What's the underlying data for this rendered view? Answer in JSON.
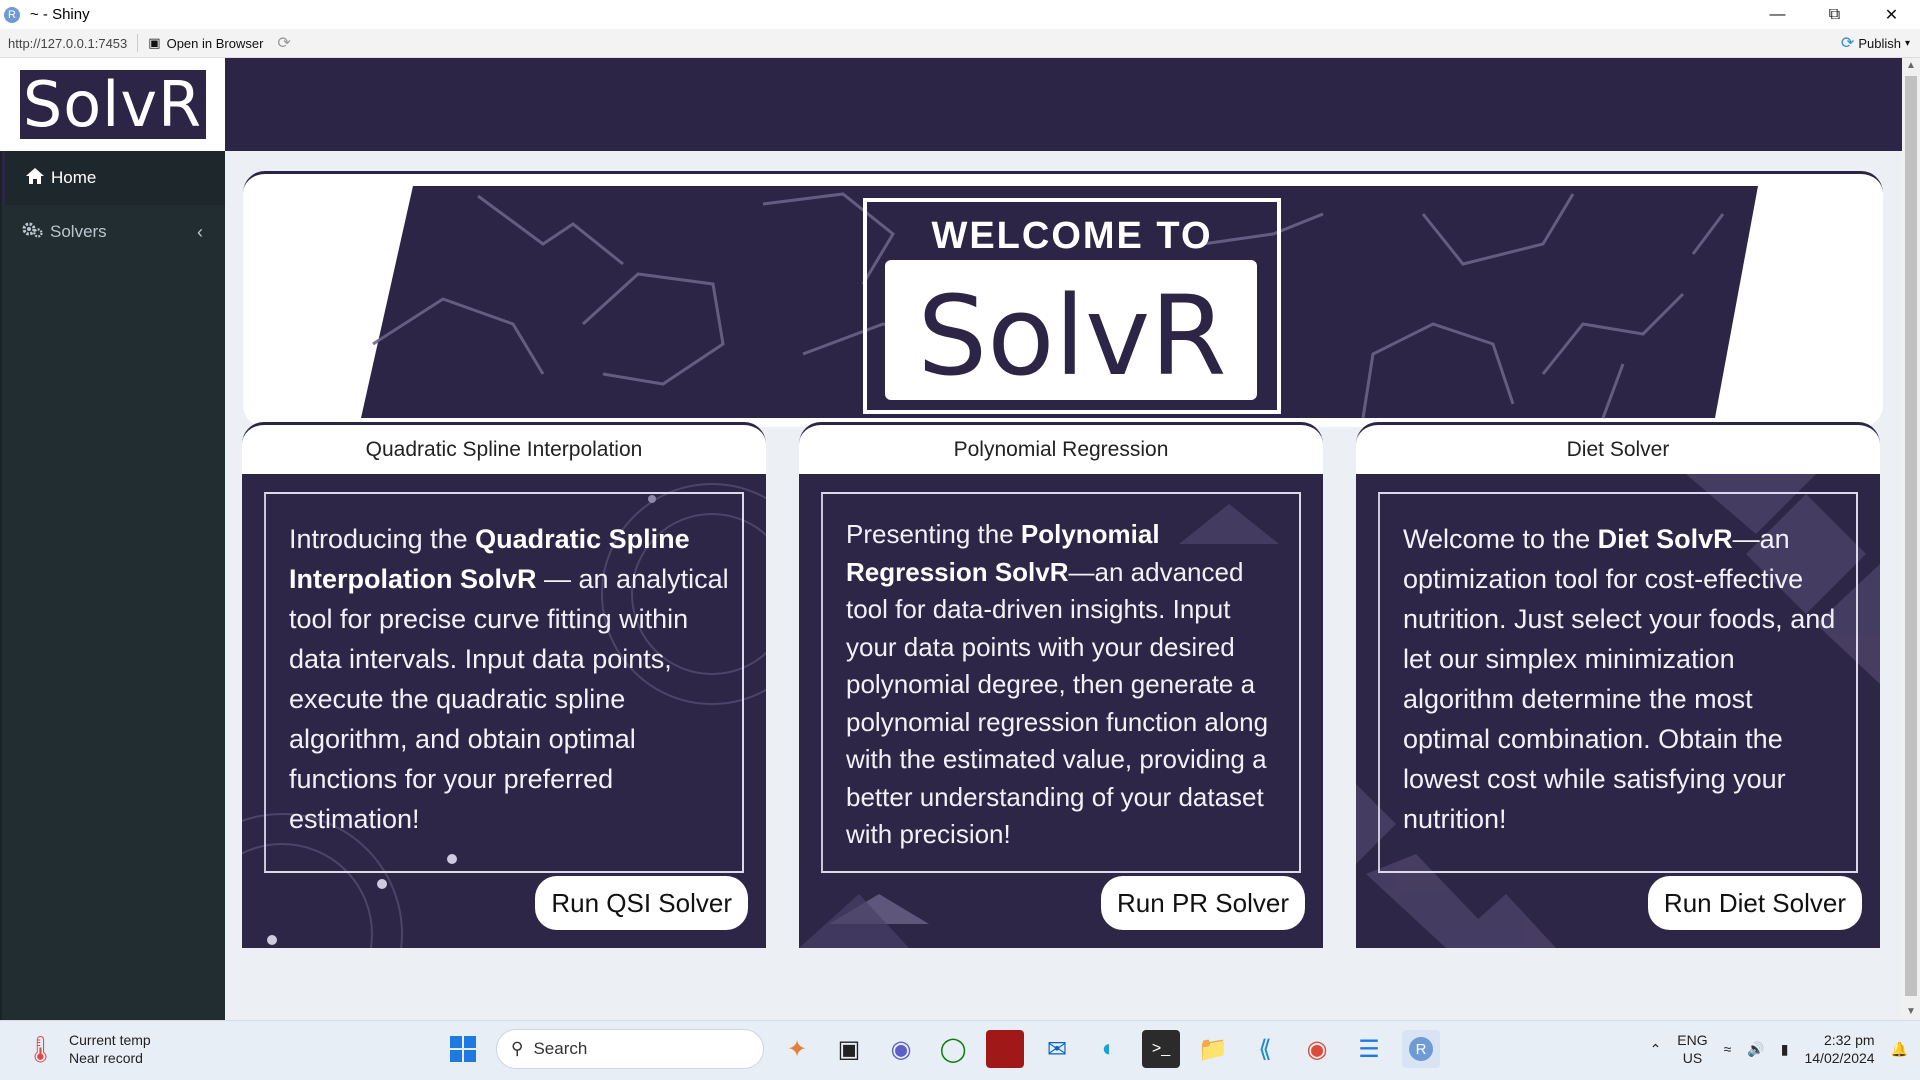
{
  "window": {
    "title": "~ - Shiny",
    "app_icon_letter": "R"
  },
  "toolbar": {
    "url": "http://127.0.0.1:7453",
    "open_in_browser": "Open in Browser",
    "publish": "Publish"
  },
  "app": {
    "logo": "SolvR",
    "sidebar": {
      "items": [
        {
          "label": "Home",
          "icon": "home-icon"
        },
        {
          "label": "Solvers",
          "icon": "gears-icon"
        }
      ]
    },
    "banner": {
      "welcome": "WELCOME TO",
      "brand": "SolvR"
    },
    "cards": [
      {
        "title": "Quadratic Spline Interpolation",
        "intro": "Introducing the ",
        "highlight": "Quadratic Spline Interpolation SolvR",
        "text": " — an analytical tool for precise curve fitting within data intervals. Input data points, execute the quadratic spline algorithm, and obtain optimal functions for your preferred estimation!",
        "button": "Run QSI Solver"
      },
      {
        "title": "Polynomial Regression",
        "intro": "Presenting the ",
        "highlight": "Polynomial Regression SolvR",
        "text": "—an advanced tool for data-driven insights. Input your data points with your desired polynomial degree, then generate a polynomial regression function along with the estimated value, providing a better understanding of your dataset with precision!",
        "button": "Run PR Solver"
      },
      {
        "title": "Diet Solver",
        "intro": "Welcome to the ",
        "highlight": "Diet SolvR",
        "text": "—an optimization tool for cost-effective nutrition. Just select your foods, and let our simplex minimization algorithm determine the most optimal combination. Obtain the lowest cost while satisfying your nutrition!",
        "button": "Run Diet Solver"
      }
    ],
    "colors": {
      "brand": "#2c2546",
      "sidebar": "#222d32"
    }
  },
  "taskbar": {
    "weather_line1": "Current temp",
    "weather_line2": "Near record",
    "search": "Search",
    "lang_line1": "ENG",
    "lang_line2": "US",
    "time": "2:32 pm",
    "date": "14/02/2024"
  }
}
